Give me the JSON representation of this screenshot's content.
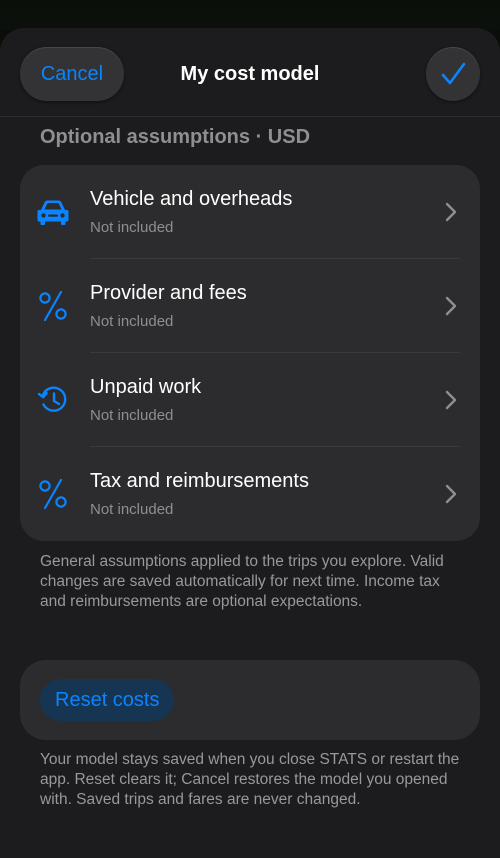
{
  "nav": {
    "cancel_label": "Cancel",
    "title": "My cost model",
    "done_icon": "checkmark-icon"
  },
  "section": {
    "header": "Optional assumptions · USD"
  },
  "rows": [
    {
      "icon": "car-icon",
      "title": "Vehicle and overheads",
      "subtitle": "Not included"
    },
    {
      "icon": "percent-icon",
      "title": "Provider and fees",
      "subtitle": "Not included"
    },
    {
      "icon": "clock-history-icon",
      "title": "Unpaid work",
      "subtitle": "Not included"
    },
    {
      "icon": "percent-icon",
      "title": "Tax and reimbursements",
      "subtitle": "Not included"
    }
  ],
  "footnote_assumptions": "General assumptions applied to the trips you explore. Valid changes are saved automatically for next time. Income tax and reimbursements are optional expectations.",
  "reset": {
    "label": "Reset costs"
  },
  "footnote_reset": "Your model stays saved when you close STATS or restart the app. Reset clears it; Cancel restores the model you opened with. Saved trips and fares are never changed.",
  "colors": {
    "accent": "#0a84ff",
    "background": "#1c1c1e",
    "card": "#2c2c2e",
    "secondary_text": "#8e8e93"
  }
}
